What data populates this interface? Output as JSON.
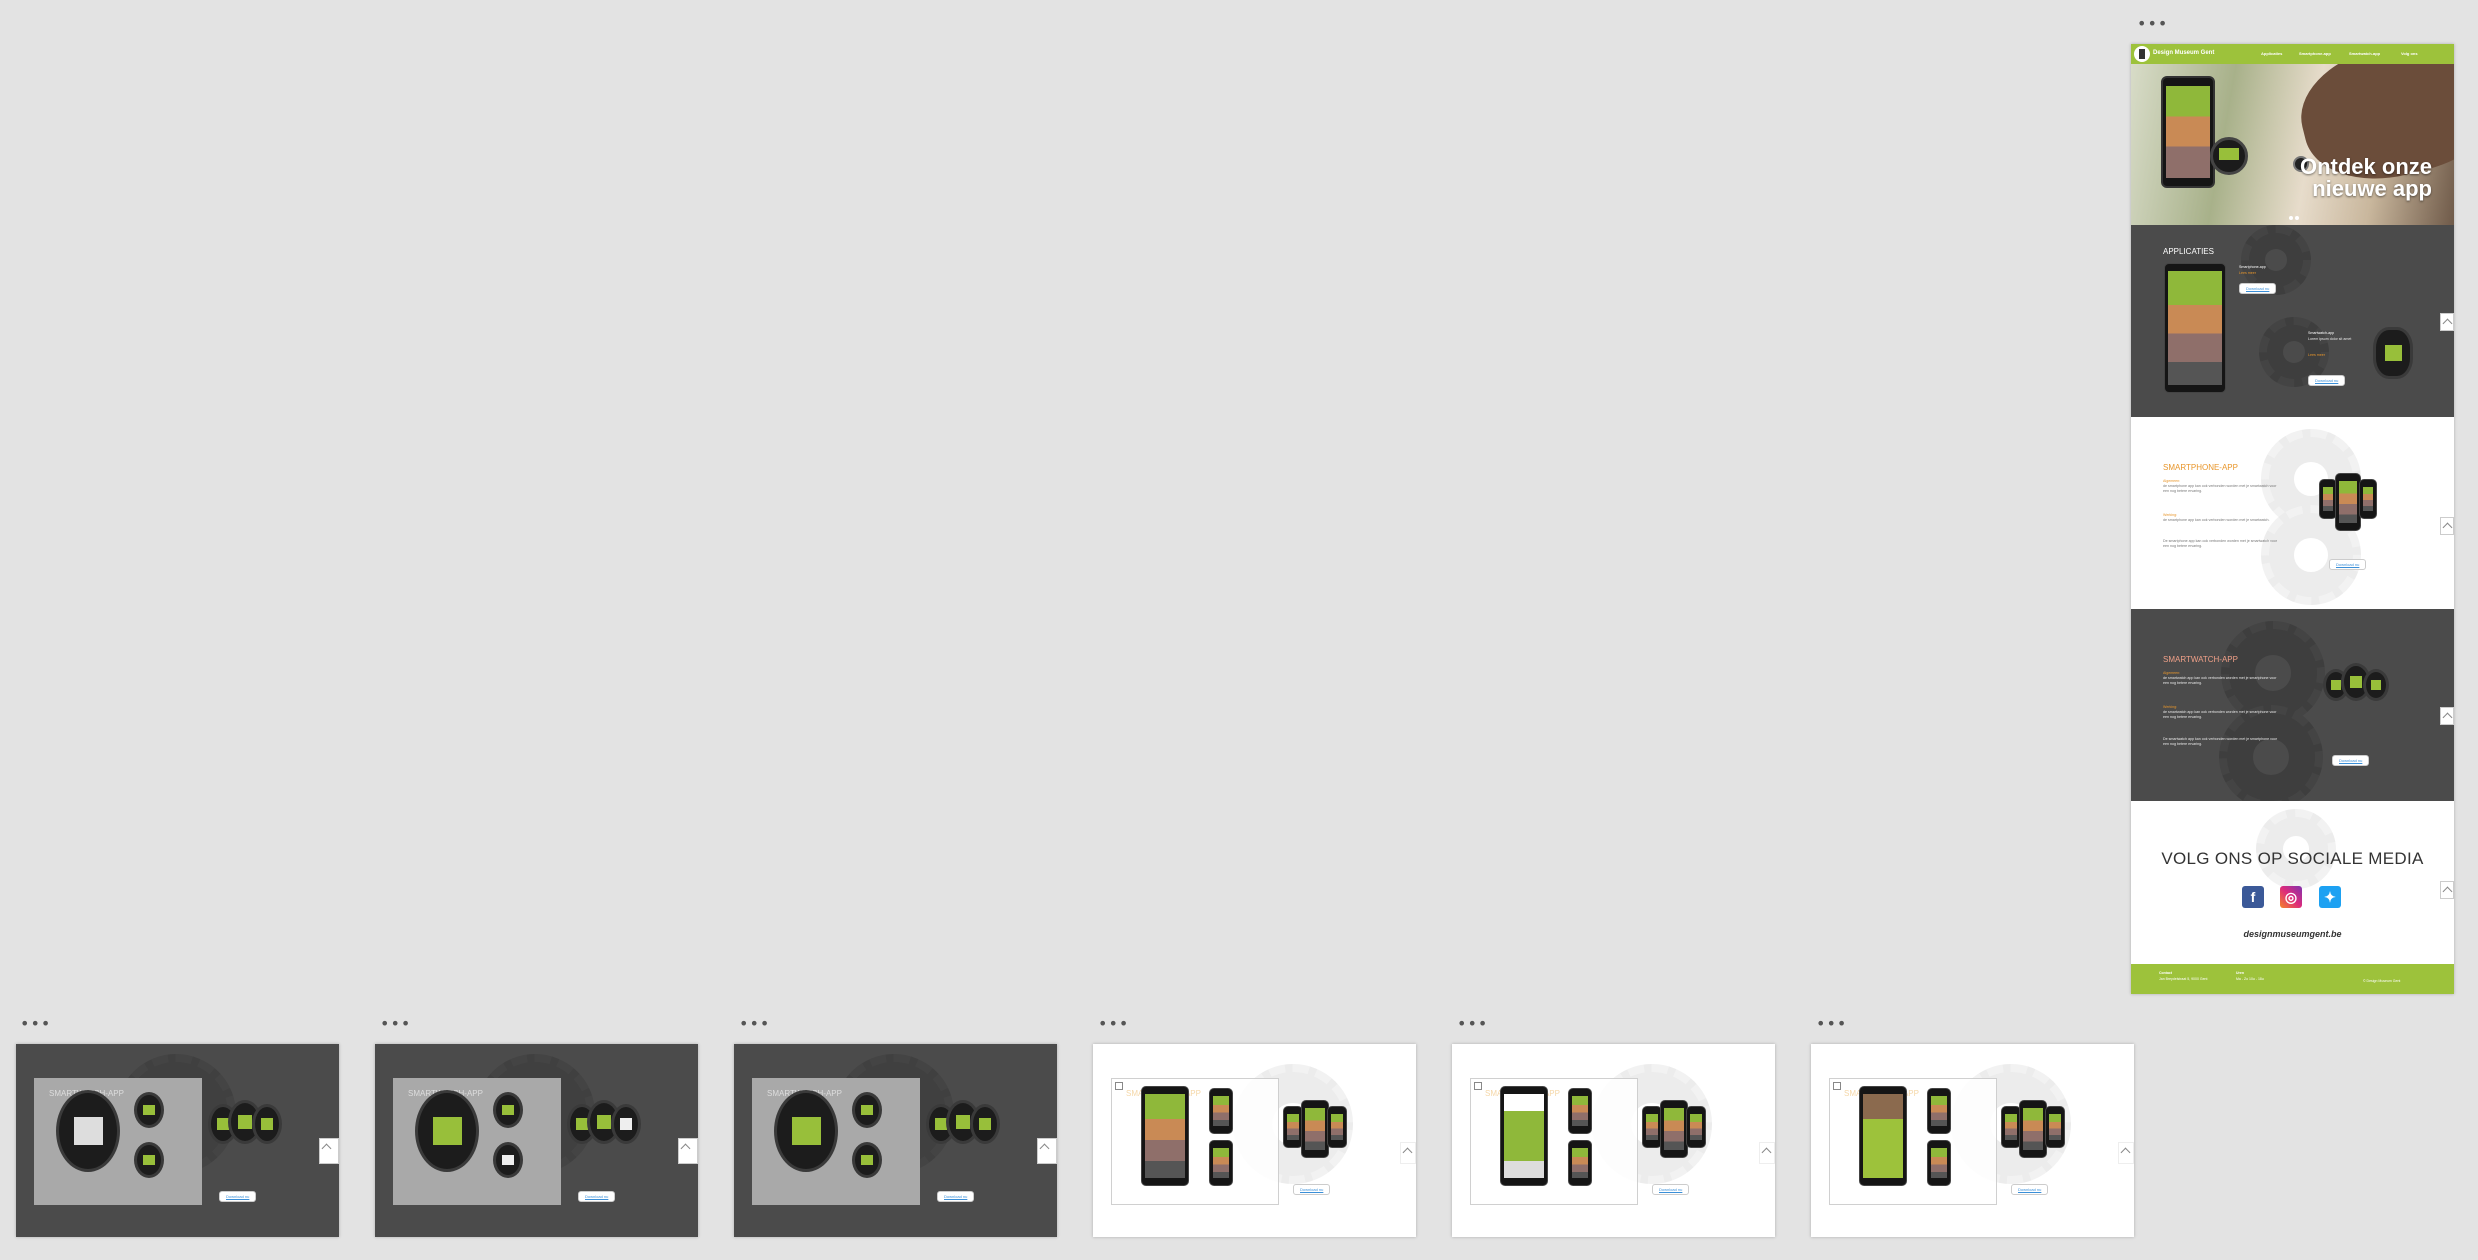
{
  "artboard": {
    "menu_dots": "•••",
    "nav": {
      "brand": "Design Museum Gent",
      "items": [
        "Applicaties",
        "Smartphone-app",
        "Smartwatch-app",
        "Volg ons"
      ]
    },
    "hero": {
      "title": "Ontdek onze nieuwe app"
    },
    "applicaties": {
      "title": "APPLICATIES",
      "phone_caption": "Smartphone-app",
      "phone_link": "Lees meer",
      "watch_caption": "Smartwatch-app",
      "watch_text": "Lorem ipsum dolor sit amet",
      "watch_link": "Lees meer",
      "download": "Download nu"
    },
    "smartphone": {
      "title": "SMARTPHONE-APP",
      "para1_lead": "Algemeen:",
      "para1": "de smartphone app kan ook verbonden worden met je smartwatch voor een nog betere ervaring.",
      "para2_lead": "Werking:",
      "para2": "de smartphone app kan ook verbonden worden met je smartwatch.",
      "para3": "De smartphone app kan ook verbonden worden met je smartwatch voor een nog betere ervaring.",
      "download": "Download nu"
    },
    "smartwatch": {
      "title": "SMARTWATCH-APP",
      "para1_lead": "Algemeen:",
      "para1": "de smartwatch app kan ook verbonden worden met je smartphone voor een nog betere ervaring.",
      "para2_lead": "Werking:",
      "para2": "de smartwatch app kan ook verbonden worden met je smartphone voor een nog betere ervaring.",
      "para3": "De smartwatch app kan ook verbonden worden met je smartphone voor een nog betere ervaring.",
      "download": "Download nu"
    },
    "social": {
      "title": "VOLG ONS OP SOCIALE MEDIA",
      "site": "designmuseumgent.be",
      "icons": [
        "facebook-icon",
        "instagram-icon",
        "twitter-icon"
      ]
    },
    "footer": {
      "contact_title": "Contact",
      "contact_text": "Jan Breydelstraat 5, 9000 Gent",
      "hours_title": "Uren",
      "hours_text": "Ma - Zo 10u - 18u",
      "copyright": "© Design Museum Gent"
    }
  },
  "thumbnails": [
    {
      "type": "dark",
      "title": "SMARTWATCH-APP",
      "download": "Download nu",
      "menu_dots": "•••"
    },
    {
      "type": "dark",
      "title": "SMARTWATCH-APP",
      "download": "Download nu",
      "menu_dots": "•••"
    },
    {
      "type": "dark",
      "title": "SMARTWATCH-APP",
      "download": "Download nu",
      "menu_dots": "•••"
    },
    {
      "type": "light",
      "title": "SMARTPHONE-APP",
      "download": "Download nu",
      "menu_dots": "•••"
    },
    {
      "type": "light",
      "title": "SMARTPHONE-APP",
      "download": "Download nu",
      "menu_dots": "•••"
    },
    {
      "type": "light",
      "title": "SMARTPHONE-APP",
      "download": "Download nu",
      "menu_dots": "•••"
    }
  ],
  "colors": {
    "canvas": "#e3e3e3",
    "brand_green": "#9dc23b",
    "dark_section": "#4b4b4b",
    "accent_orange": "#e8962b",
    "link_blue": "#3a8fd8"
  }
}
